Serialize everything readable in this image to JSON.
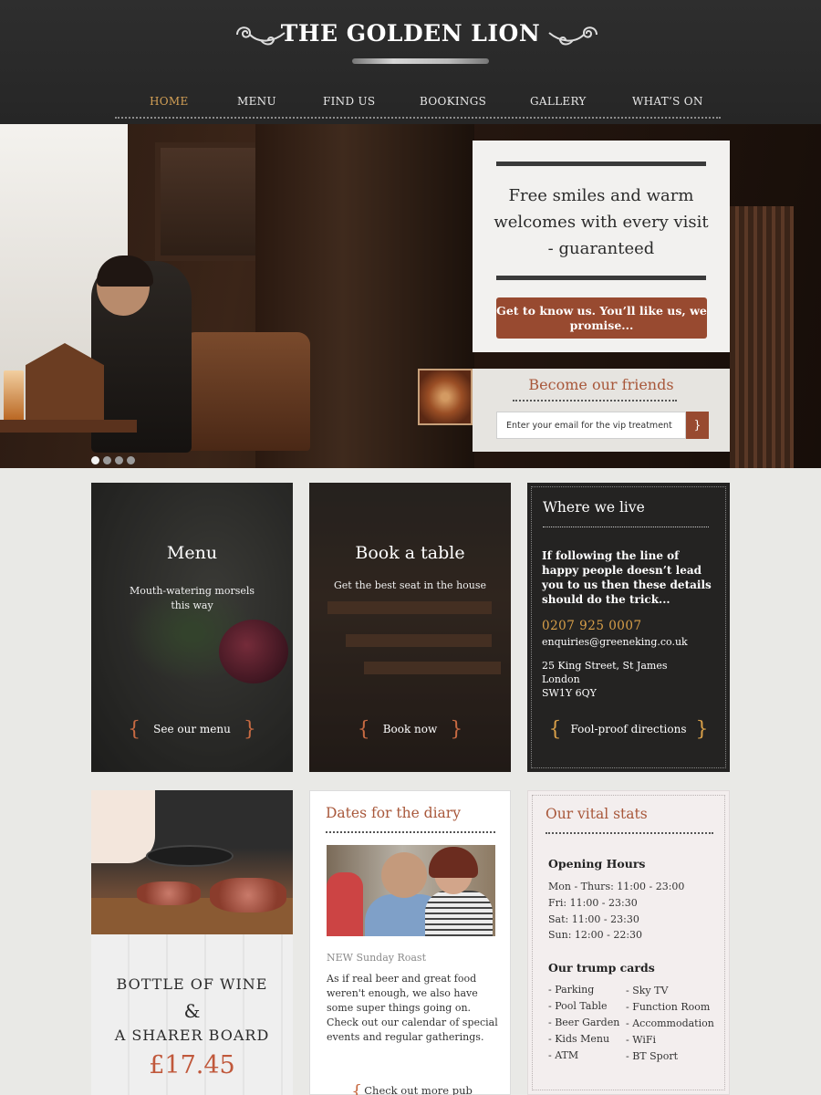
{
  "brand": {
    "name": "THE GOLDEN LION"
  },
  "nav": {
    "items": [
      "HOME",
      "MENU",
      "FIND US",
      "BOOKINGS",
      "GALLERY",
      "WHAT’S ON"
    ],
    "active": "HOME"
  },
  "hero": {
    "tagline": "Free smiles and warm welcomes with every visit - guaranteed",
    "cta_label": "Get to know us. You’ll like us, we promise...",
    "slides": {
      "count": 4,
      "active": 1
    }
  },
  "newsletter": {
    "title": "Become our friends",
    "placeholder": "Enter your email for the vip treatment",
    "submit_label": "}"
  },
  "menu_card": {
    "title": "Menu",
    "subtitle": "Mouth-watering morsels this way",
    "link_label": "See our menu"
  },
  "book_card": {
    "title": "Book a table",
    "subtitle": "Get the best seat in the house",
    "link_label": "Book now"
  },
  "where": {
    "title": "Where we live",
    "intro": "If following the line of happy people doesn’t lead you to us then these details should do the trick...",
    "phone": "0207 925 0007",
    "email": "enquiries@greeneking.co.uk",
    "address": [
      "25 King Street, St James",
      "London",
      "SW1Y 6QY"
    ],
    "link_label": "Fool-proof directions"
  },
  "offer": {
    "line1": "BOTTLE OF WINE",
    "amp": "&",
    "line2": "A SHARER BOARD",
    "price": "£17.45"
  },
  "diary": {
    "title": "Dates for the diary",
    "event_title": "NEW Sunday Roast",
    "event_text": "As if real beer and great food weren't enough, we also have some super things going on. Check out our calendar of special events and regular gatherings.",
    "link_label": "Check out more pub happenings"
  },
  "stats": {
    "title": "Our vital stats",
    "hours_heading": "Opening Hours",
    "hours": [
      "Mon - Thurs: 11:00 - 23:00",
      "Fri: 11:00 - 23:30",
      "Sat: 11:00 - 23:30",
      "Sun: 12:00 - 22:30"
    ],
    "trump_heading": "Our trump cards",
    "trump_left": [
      "- Parking",
      "- Pool Table",
      "- Beer Garden",
      "- Kids Menu",
      "- ATM"
    ],
    "trump_right": [
      "- Sky TV",
      "- Function Room",
      "- Accommodation",
      "- WiFi",
      "- BT Sport"
    ]
  },
  "colors": {
    "header_bg": "#2b2b2b",
    "nav_active": "#d3a056",
    "accent_rust": "#984a30",
    "heading_rust": "#a8573a",
    "phone_gold": "#d9a049",
    "price": "#c0583b"
  },
  "icons": {
    "logo_flourish": "scroll-flourish-icon",
    "submit": "curly-brace-icon"
  }
}
